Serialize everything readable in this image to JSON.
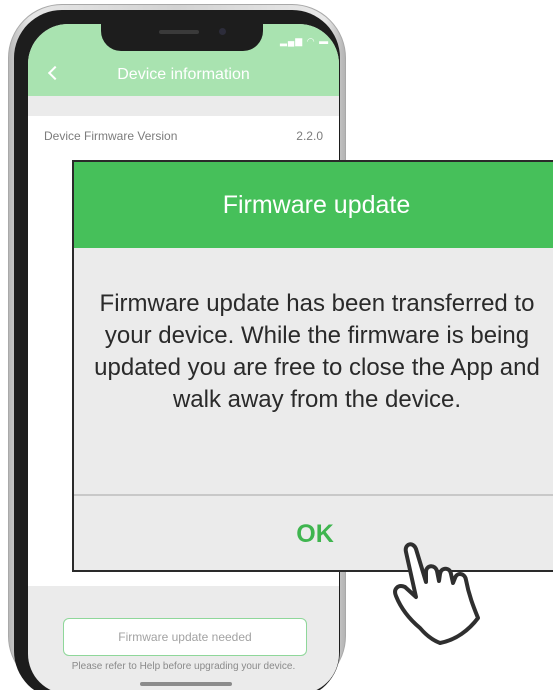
{
  "app": {
    "header_title": "Device information",
    "firmware_label": "Device Firmware Version",
    "firmware_version": "2.2.0",
    "update_needed_button": "Firmware update needed",
    "help_text": "Please refer to Help before upgrading your device."
  },
  "dialog": {
    "title": "Firmware update",
    "message": "Firmware update has been transferred to your device. While the firmware is being updated you are free to close the App and walk away from the device.",
    "ok_label": "OK"
  },
  "icons": {
    "back": "chevron-left-icon",
    "cursor": "hand-pointer-icon",
    "status": "signal-wifi-battery-icons"
  },
  "colors": {
    "header_light_green": "#a9e3b0",
    "dialog_green": "#46c05a",
    "ok_green": "#3fb54f"
  }
}
